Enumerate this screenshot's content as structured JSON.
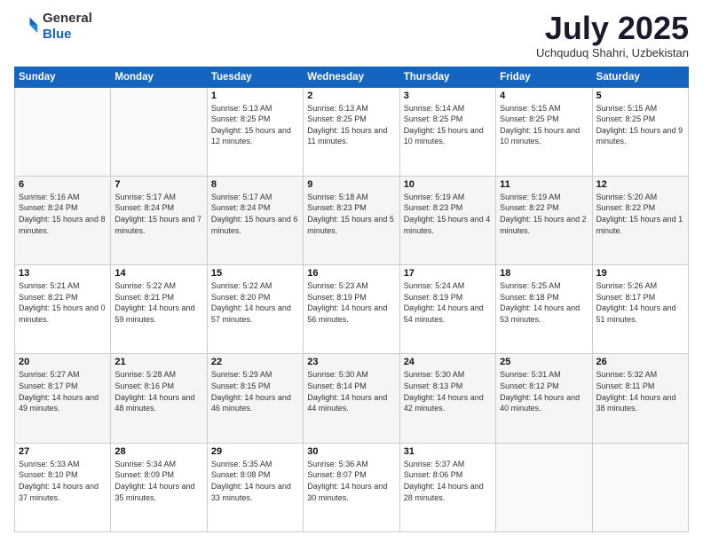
{
  "logo": {
    "general": "General",
    "blue": "Blue"
  },
  "header": {
    "month": "July 2025",
    "location": "Uchquduq Shahri, Uzbekistan"
  },
  "weekdays": [
    "Sunday",
    "Monday",
    "Tuesday",
    "Wednesday",
    "Thursday",
    "Friday",
    "Saturday"
  ],
  "weeks": [
    [
      {
        "day": "",
        "info": ""
      },
      {
        "day": "",
        "info": ""
      },
      {
        "day": "1",
        "info": "Sunrise: 5:13 AM\nSunset: 8:25 PM\nDaylight: 15 hours and 12 minutes."
      },
      {
        "day": "2",
        "info": "Sunrise: 5:13 AM\nSunset: 8:25 PM\nDaylight: 15 hours and 11 minutes."
      },
      {
        "day": "3",
        "info": "Sunrise: 5:14 AM\nSunset: 8:25 PM\nDaylight: 15 hours and 10 minutes."
      },
      {
        "day": "4",
        "info": "Sunrise: 5:15 AM\nSunset: 8:25 PM\nDaylight: 15 hours and 10 minutes."
      },
      {
        "day": "5",
        "info": "Sunrise: 5:15 AM\nSunset: 8:25 PM\nDaylight: 15 hours and 9 minutes."
      }
    ],
    [
      {
        "day": "6",
        "info": "Sunrise: 5:16 AM\nSunset: 8:24 PM\nDaylight: 15 hours and 8 minutes."
      },
      {
        "day": "7",
        "info": "Sunrise: 5:17 AM\nSunset: 8:24 PM\nDaylight: 15 hours and 7 minutes."
      },
      {
        "day": "8",
        "info": "Sunrise: 5:17 AM\nSunset: 8:24 PM\nDaylight: 15 hours and 6 minutes."
      },
      {
        "day": "9",
        "info": "Sunrise: 5:18 AM\nSunset: 8:23 PM\nDaylight: 15 hours and 5 minutes."
      },
      {
        "day": "10",
        "info": "Sunrise: 5:19 AM\nSunset: 8:23 PM\nDaylight: 15 hours and 4 minutes."
      },
      {
        "day": "11",
        "info": "Sunrise: 5:19 AM\nSunset: 8:22 PM\nDaylight: 15 hours and 2 minutes."
      },
      {
        "day": "12",
        "info": "Sunrise: 5:20 AM\nSunset: 8:22 PM\nDaylight: 15 hours and 1 minute."
      }
    ],
    [
      {
        "day": "13",
        "info": "Sunrise: 5:21 AM\nSunset: 8:21 PM\nDaylight: 15 hours and 0 minutes."
      },
      {
        "day": "14",
        "info": "Sunrise: 5:22 AM\nSunset: 8:21 PM\nDaylight: 14 hours and 59 minutes."
      },
      {
        "day": "15",
        "info": "Sunrise: 5:22 AM\nSunset: 8:20 PM\nDaylight: 14 hours and 57 minutes."
      },
      {
        "day": "16",
        "info": "Sunrise: 5:23 AM\nSunset: 8:19 PM\nDaylight: 14 hours and 56 minutes."
      },
      {
        "day": "17",
        "info": "Sunrise: 5:24 AM\nSunset: 8:19 PM\nDaylight: 14 hours and 54 minutes."
      },
      {
        "day": "18",
        "info": "Sunrise: 5:25 AM\nSunset: 8:18 PM\nDaylight: 14 hours and 53 minutes."
      },
      {
        "day": "19",
        "info": "Sunrise: 5:26 AM\nSunset: 8:17 PM\nDaylight: 14 hours and 51 minutes."
      }
    ],
    [
      {
        "day": "20",
        "info": "Sunrise: 5:27 AM\nSunset: 8:17 PM\nDaylight: 14 hours and 49 minutes."
      },
      {
        "day": "21",
        "info": "Sunrise: 5:28 AM\nSunset: 8:16 PM\nDaylight: 14 hours and 48 minutes."
      },
      {
        "day": "22",
        "info": "Sunrise: 5:29 AM\nSunset: 8:15 PM\nDaylight: 14 hours and 46 minutes."
      },
      {
        "day": "23",
        "info": "Sunrise: 5:30 AM\nSunset: 8:14 PM\nDaylight: 14 hours and 44 minutes."
      },
      {
        "day": "24",
        "info": "Sunrise: 5:30 AM\nSunset: 8:13 PM\nDaylight: 14 hours and 42 minutes."
      },
      {
        "day": "25",
        "info": "Sunrise: 5:31 AM\nSunset: 8:12 PM\nDaylight: 14 hours and 40 minutes."
      },
      {
        "day": "26",
        "info": "Sunrise: 5:32 AM\nSunset: 8:11 PM\nDaylight: 14 hours and 38 minutes."
      }
    ],
    [
      {
        "day": "27",
        "info": "Sunrise: 5:33 AM\nSunset: 8:10 PM\nDaylight: 14 hours and 37 minutes."
      },
      {
        "day": "28",
        "info": "Sunrise: 5:34 AM\nSunset: 8:09 PM\nDaylight: 14 hours and 35 minutes."
      },
      {
        "day": "29",
        "info": "Sunrise: 5:35 AM\nSunset: 8:08 PM\nDaylight: 14 hours and 33 minutes."
      },
      {
        "day": "30",
        "info": "Sunrise: 5:36 AM\nSunset: 8:07 PM\nDaylight: 14 hours and 30 minutes."
      },
      {
        "day": "31",
        "info": "Sunrise: 5:37 AM\nSunset: 8:06 PM\nDaylight: 14 hours and 28 minutes."
      },
      {
        "day": "",
        "info": ""
      },
      {
        "day": "",
        "info": ""
      }
    ]
  ]
}
